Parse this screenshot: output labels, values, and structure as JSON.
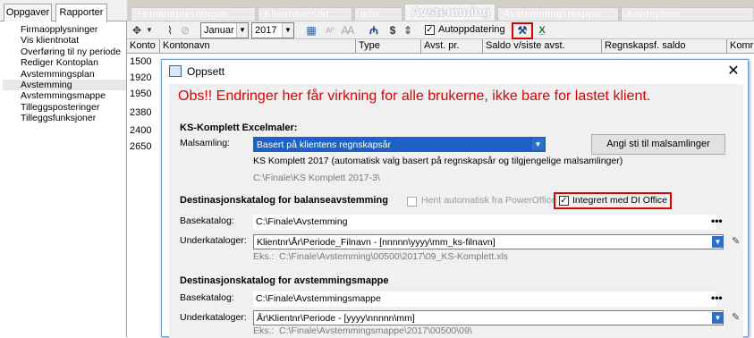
{
  "left_tabs": [
    "Oppgaver",
    "Rapporter"
  ],
  "left_items": [
    "Firmaopplysninger",
    "Vis klientnotat",
    "Overføring til ny periode",
    "Rediger Kontoplan",
    "Avstemmingsplan",
    "Avstemming",
    "Avstemmingsmappe",
    "Tilleggsposteringer",
    "Tilleggsfunksjoner"
  ],
  "selected_left_item": "Avstemming",
  "top_tabs": [
    "Firmaopplysninger",
    "Klientoversikt",
    "Info",
    "Avstemming",
    "Avstemmingsmappe",
    "Kontoplan"
  ],
  "active_top_tab": "Avstemming",
  "toolbar": {
    "month": "Januar",
    "year": "2017",
    "autoupdate_label": "Autoppdatering",
    "autoupdate_checked": true,
    "icons": [
      "nav-arrows-icon",
      "paperclip-icon",
      "attachment-remove-icon",
      "calendar-icon",
      "text-ap-icon",
      "letter-a-icon",
      "binoculars-icon",
      "dollar-icon",
      "sort-icon",
      "tools-icon",
      "excel-icon"
    ]
  },
  "grid": {
    "columns": [
      "Konto",
      "Kontonavn",
      "Type",
      "Avst. pr.",
      "Saldo v/siste avst.",
      "Regnskapsf. saldo",
      "Komr"
    ],
    "rows": [
      "1500",
      "1920",
      "1950",
      "2380",
      "2400",
      "2650"
    ]
  },
  "dialog": {
    "title": "Oppsett",
    "close": "✕",
    "warning": "Obs!! Endringer her får virkning for alle brukerne, ikke bare for lastet klient.",
    "excel_section": "KS-Komplett Excelmaler:",
    "malsamling_label": "Malsamling:",
    "malsamling_value": "Basert på klientens regnskapsår",
    "malsamling_desc": "KS Komplett 2017 (automatisk valg basert på regnskapsår og tilgjengelige malsamlinger)",
    "malsamling_path": "C:\\Finale\\KS Komplett 2017-3\\",
    "angi_button": "Angi sti til malsamlinger",
    "balance_section": "Destinasjonskatalog for balanseavstemming",
    "hent_label": "Hent automatisk fra PowerOffice",
    "hent_checked": false,
    "integrert_label": "Integrert med DI Office",
    "integrert_checked": true,
    "basekatalog_label": "Basekatalog:",
    "underkataloger_label": "Underkataloger:",
    "eks_label": "Eks.:",
    "balance_base": "C:\\Finale\\Avstemming",
    "balance_sub": "Klientnr\\År\\Periode_Filnavn - [nnnnn\\yyyy\\mm_ks-filnavn]",
    "balance_eks": "C:\\Finale\\Avstemming\\00500\\2017\\09_KS-Komplett.xls",
    "folder_section": "Destinasjonskatalog for avstemmingsmappe",
    "folder_base": "C:\\Finale\\Avstemmingsmappe",
    "folder_sub": "År\\Klientnr\\Periode - [yyyy\\nnnnn\\mm]",
    "folder_eks": "C:\\Finale\\Avstemmingsmappe\\2017\\00500\\09\\",
    "dots": "•••"
  }
}
